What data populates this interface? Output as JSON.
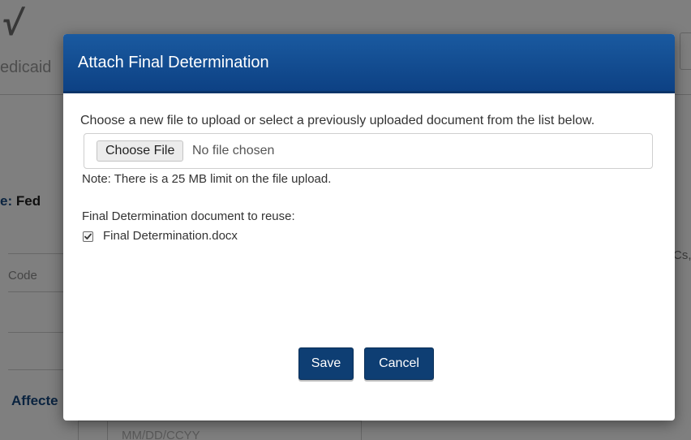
{
  "background": {
    "logo_glyph": "√",
    "app_name_partial": "edicaid",
    "type_label_partial": "e:",
    "type_value_partial": "Fed",
    "table_header_partial": "Code",
    "section_partial": "Affecte",
    "right_text_partial": "Cs,",
    "date_placeholder": "MM/DD/CCYY"
  },
  "modal": {
    "title": "Attach Final Determination",
    "intro": "Choose a new file to upload or select a previously uploaded document from the list below.",
    "file_input": {
      "button_label": "Choose File",
      "status": "No file chosen"
    },
    "note": "Note: There is a 25 MB limit on the file upload.",
    "reuse_label": "Final Determination document to reuse:",
    "documents": [
      {
        "name": "Final Determination.docx",
        "checked": true
      }
    ],
    "buttons": {
      "save": "Save",
      "cancel": "Cancel"
    }
  },
  "colors": {
    "header_blue": "#0d4184",
    "button_blue": "#0e3e73",
    "accent_text_blue": "#15467f"
  }
}
